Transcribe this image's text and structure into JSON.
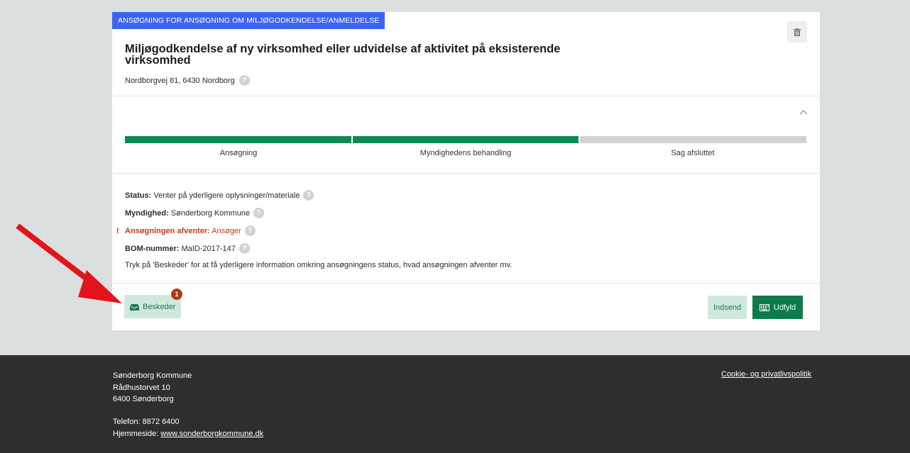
{
  "case": {
    "ribbon": "ANSØGNING FOR ANSØGNING OM MILJØGODKENDELSE/ANMELDELSE",
    "title": "Miljøgodkendelse af ny virksomhed eller udvidelse af aktivitet på eksisterende virksomhed",
    "address": "Nordborgvej 81, 6430 Nordborg"
  },
  "progress": {
    "steps": [
      {
        "label": "Ansøgning",
        "state": "done",
        "color": "#0f8a55"
      },
      {
        "label": "Myndighedens behandling",
        "state": "done",
        "color": "#0f8a55"
      },
      {
        "label": "Sag afsluttet",
        "state": "pending",
        "color": "#d2d2d2"
      }
    ]
  },
  "info": {
    "status_label": "Status:",
    "status_value": "Venter på yderligere oplysninger/materiale",
    "authority_label": "Myndighed:",
    "authority_value": "Sønderborg Kommune",
    "awaiting_label": "Ansøgningen afventer:",
    "awaiting_value": "Ansøger",
    "bom_label": "BOM-nummer:",
    "bom_value": "MaID-2017-147",
    "note": "Tryk på 'Beskeder' for at få yderligere information omkring ansøgningens status, hvad ansøgningen afventer mv."
  },
  "actions": {
    "messages_label": "Beskeder",
    "messages_count": "1",
    "submit_label": "Indsend",
    "fill_label": "Udfyld"
  },
  "footer": {
    "org": "Sønderborg Kommune",
    "street": "Rådhustorvet 10",
    "city": "6400 Sønderborg",
    "phone": "Telefon: 8872 6400",
    "website_label": "Hjemmeside:",
    "website": "www.sonderborgkommune.dk",
    "cookie": "Cookie- og privatlivspolitik"
  },
  "colors": {
    "accent_blue": "#3d63f5",
    "green": "#0f7a49",
    "alert_red": "#c93a1d",
    "arrow_red": "#e3141b"
  }
}
